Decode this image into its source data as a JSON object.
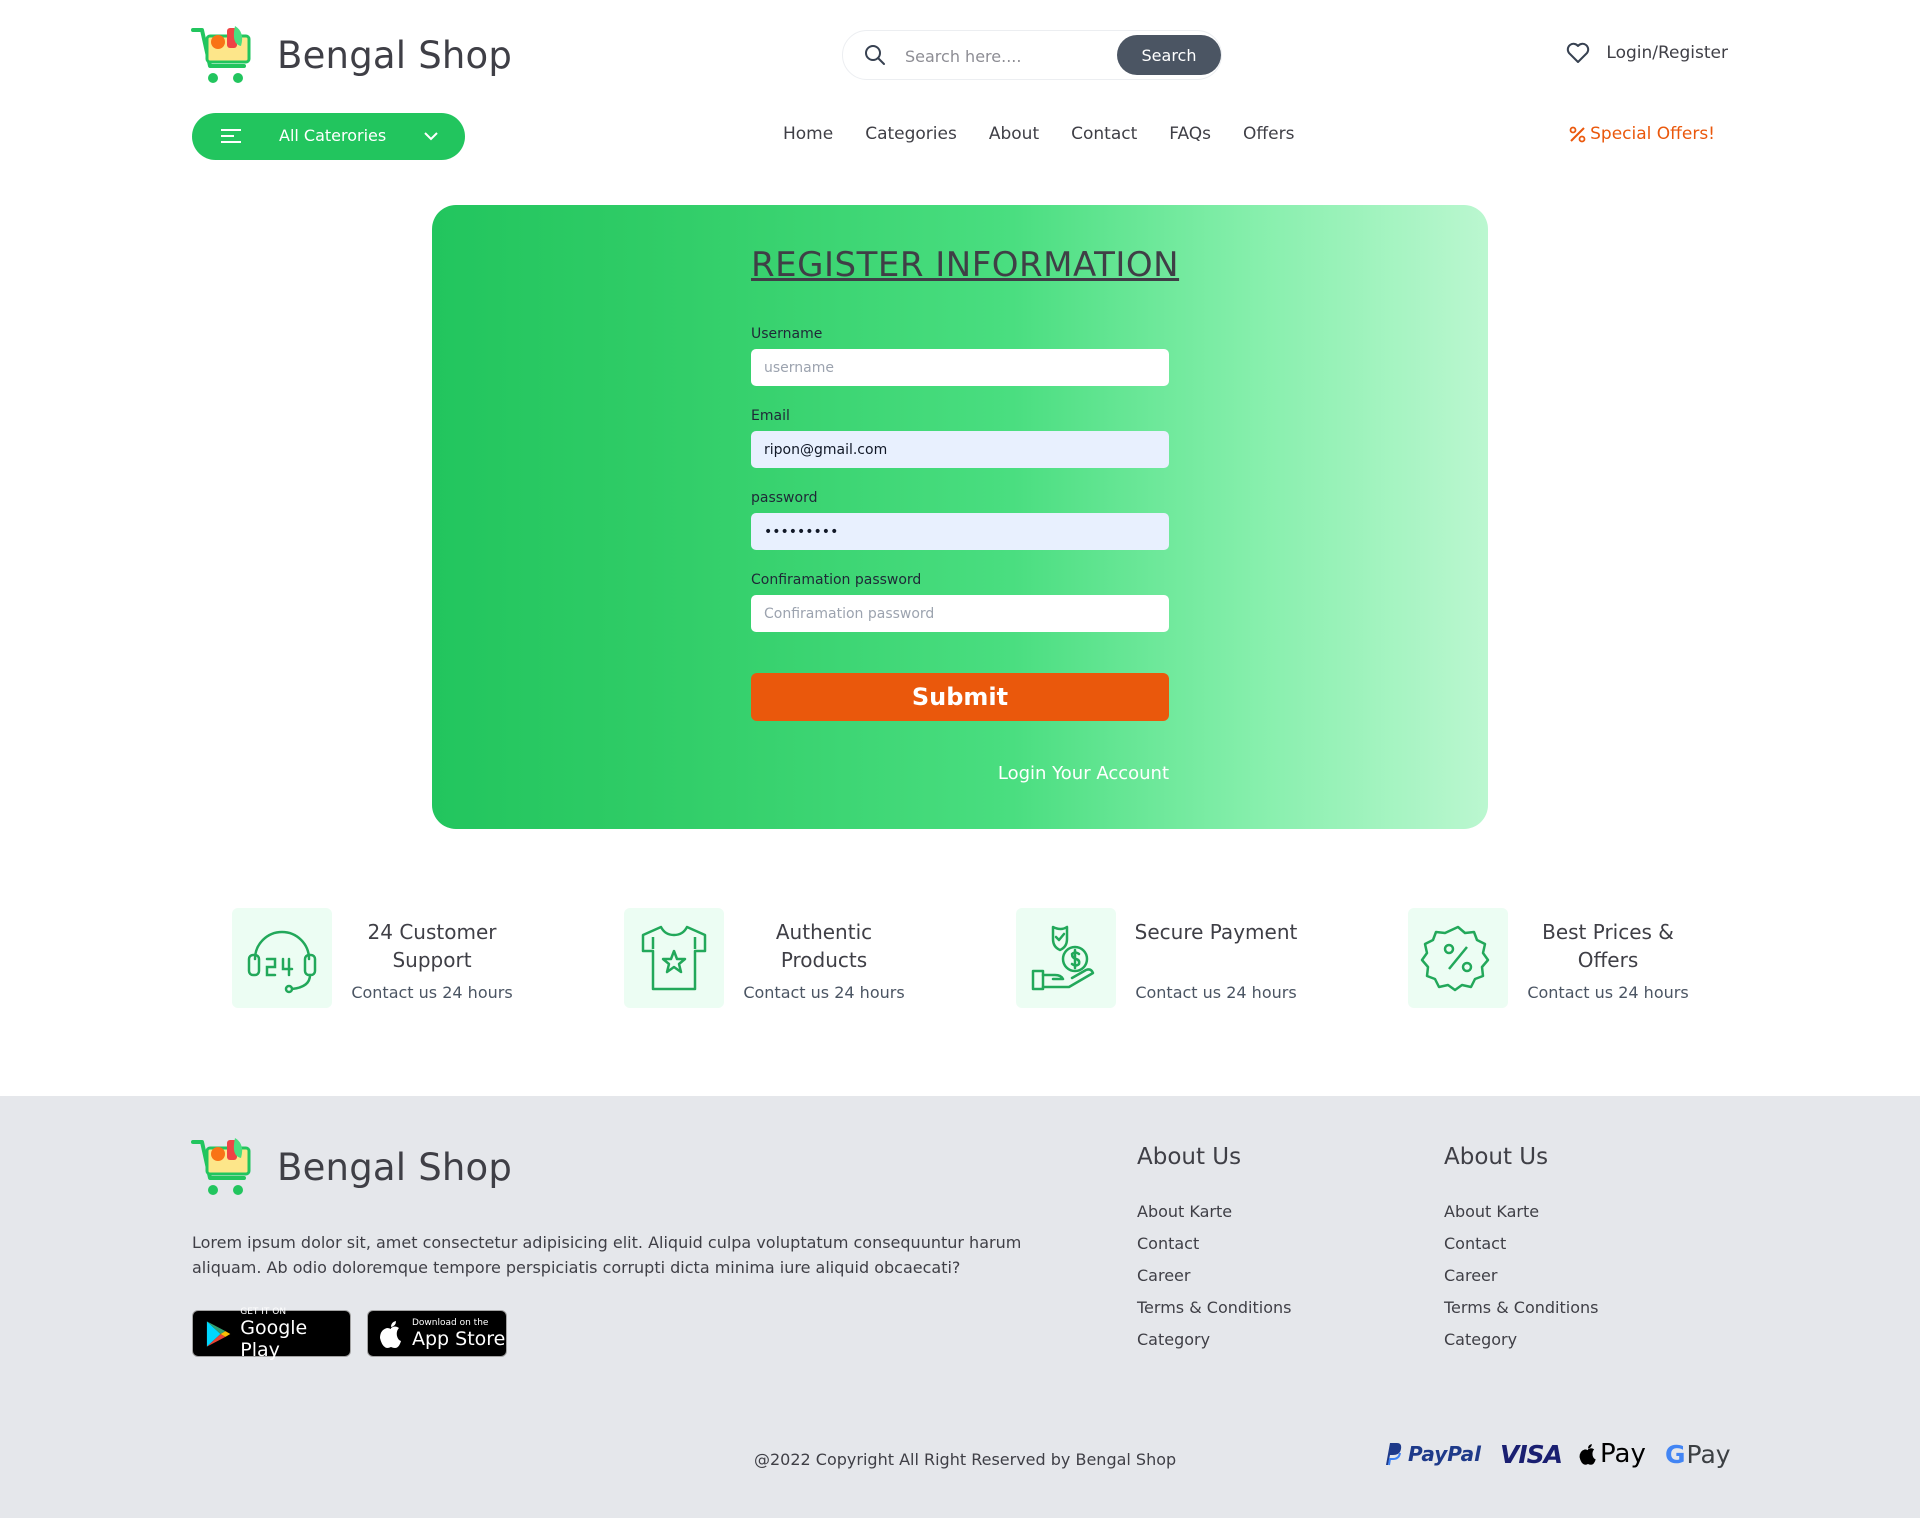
{
  "header": {
    "brand": "Bengal Shop",
    "search": {
      "placeholder": "Search here....",
      "button": "Search"
    },
    "login_register": "Login/Register",
    "all_categories": "All Caterories",
    "nav": [
      "Home",
      "Categories",
      "About",
      "Contact",
      "FAQs",
      "Offers"
    ],
    "special_offers": "Special Offers!",
    "icons": [
      "cart-logo-icon",
      "search-icon",
      "heart-icon",
      "menu-icon",
      "chevron-down-icon",
      "percent-icon"
    ]
  },
  "register": {
    "title": "REGISTER INFORMATION",
    "username": {
      "label": "Username",
      "placeholder": "username",
      "value": ""
    },
    "email": {
      "label": "Email",
      "value": "ripon@gmail.com"
    },
    "password": {
      "label": "password",
      "value": "•••••••••"
    },
    "confirm": {
      "label": "Confiramation password",
      "placeholder": "Confiramation password",
      "value": ""
    },
    "submit": "Submit",
    "login_link": "Login Your Account"
  },
  "features": [
    {
      "title": "24 Customer Support",
      "subtitle": "Contact us 24 hours",
      "icon": "headset-24-icon"
    },
    {
      "title": "Authentic Products",
      "subtitle": "Contact us 24 hours",
      "icon": "tshirt-star-icon"
    },
    {
      "title": "Secure Payment",
      "subtitle": "Contact us 24 hours",
      "icon": "hand-shield-dollar-icon"
    },
    {
      "title": "Best Prices & Offers",
      "subtitle": "Contact us 24 hours",
      "icon": "percent-badge-icon"
    }
  ],
  "footer": {
    "brand": "Bengal Shop",
    "description": "Lorem ipsum dolor sit, amet consectetur adipisicing elit. Aliquid culpa voluptatum consequuntur harum aliquam. Ab odio doloremque tempore perspiciatis corrupti dicta minima iure aliquid obcaecati?",
    "google_play": {
      "small": "GET IT ON",
      "big": "Google Play"
    },
    "app_store": {
      "small": "Download on the",
      "big": "App Store"
    },
    "columns": [
      {
        "title": "About Us",
        "links": [
          "About Karte",
          "Contact",
          "Career",
          "Terms & Conditions",
          "Category"
        ]
      },
      {
        "title": "About Us",
        "links": [
          "About Karte",
          "Contact",
          "Career",
          "Terms & Conditions",
          "Category"
        ]
      }
    ],
    "copyright": "@2022 Copyright All Right Reserved by Bengal Shop",
    "payments": {
      "paypal": "PayPal",
      "visa": "VISA",
      "apple_pay": "Pay",
      "google_pay_g": "G",
      "google_pay": "Pay"
    }
  },
  "colors": {
    "green": "#22c55e",
    "orange": "#ea580c",
    "dark": "#4b5563",
    "footer_bg": "#e5e7eb"
  }
}
